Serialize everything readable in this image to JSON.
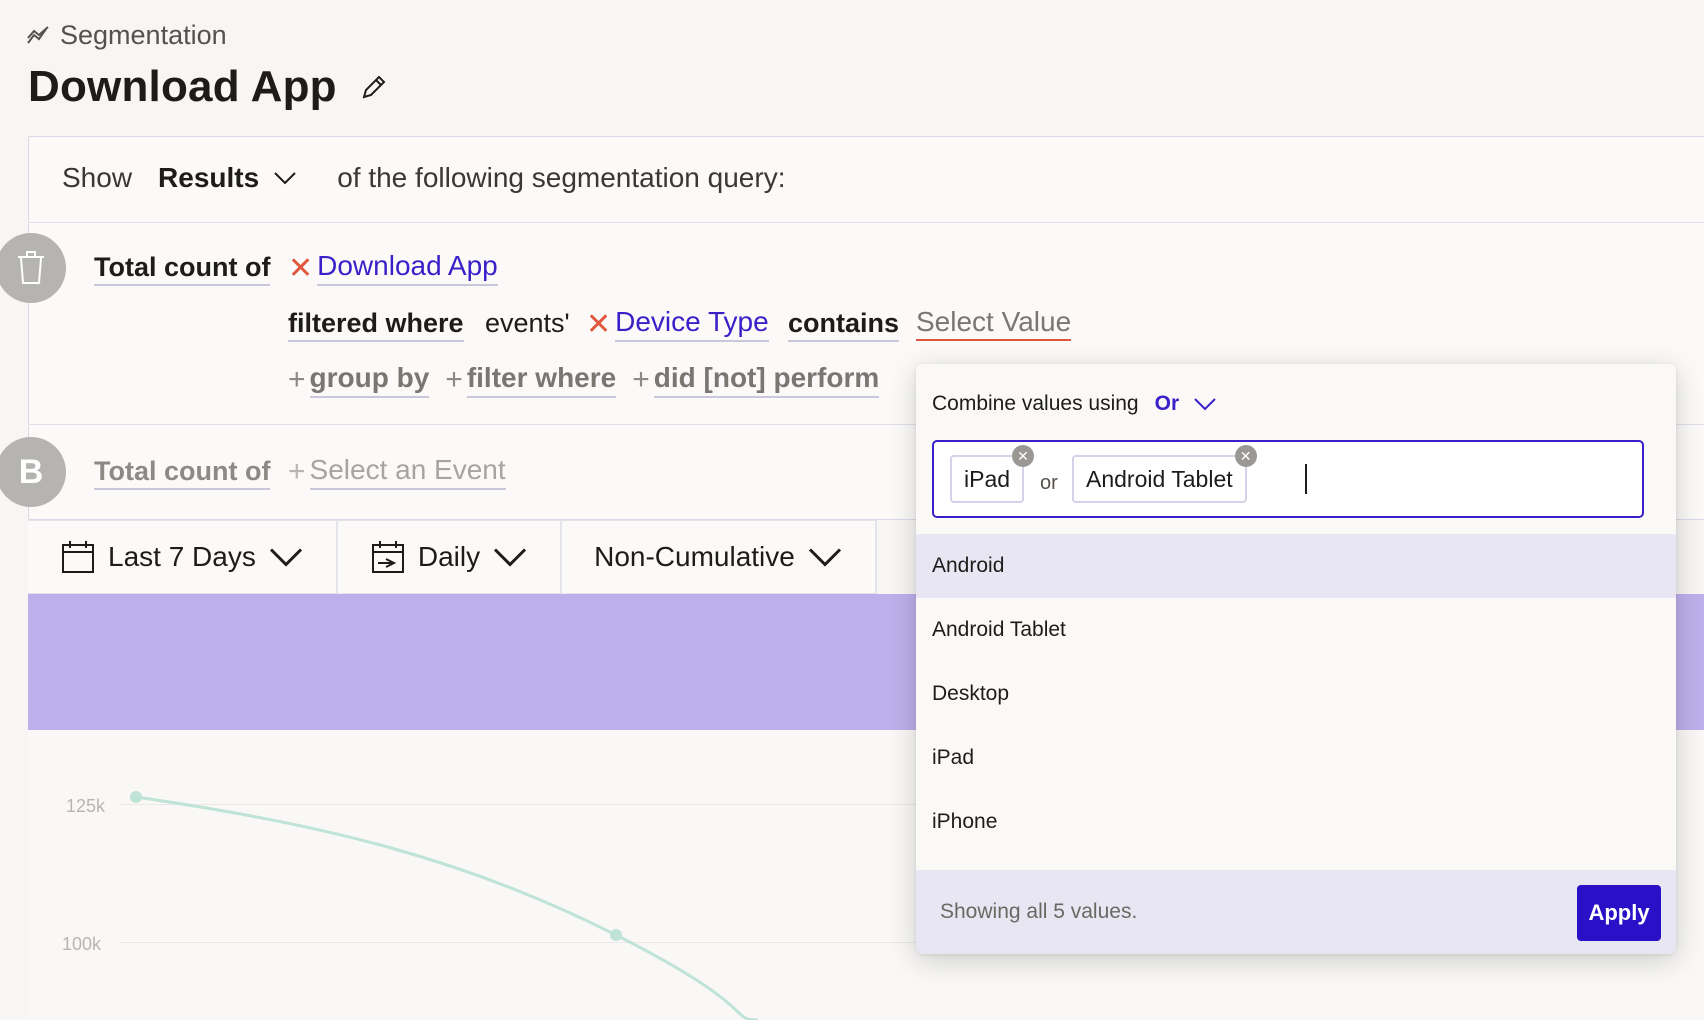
{
  "breadcrumb": {
    "label": "Segmentation"
  },
  "page": {
    "title": "Download App"
  },
  "query": {
    "show_label": "Show",
    "results_label": "Results",
    "tail_text": "of the following segmentation query:",
    "row_a": {
      "total_count_label": "Total count of",
      "event": "Download App",
      "filtered_where": "filtered where",
      "events_prefix": "events'",
      "property": "Device Type",
      "operator": "contains",
      "value_placeholder": "Select Value",
      "add_group_by": "group by",
      "add_filter_where": "filter where",
      "add_did_not_perform": "did [not] perform"
    },
    "row_b": {
      "letter": "B",
      "total_count_label": "Total count of",
      "select_event": "Select an Event"
    }
  },
  "controls": {
    "date_range": "Last 7 Days",
    "interval": "Daily",
    "mode": "Non-Cumulative"
  },
  "chart": {
    "y_ticks": [
      "125k",
      "100k"
    ]
  },
  "popover": {
    "combine_label": "Combine values using",
    "combine_value": "Or",
    "chips": [
      "iPad",
      "Android Tablet"
    ],
    "separator": "or",
    "options": [
      "Android",
      "Android Tablet",
      "Desktop",
      "iPad",
      "iPhone"
    ],
    "footer_text": "Showing all 5 values.",
    "apply_label": "Apply"
  },
  "colors": {
    "accent": "#3b1fc9",
    "band": "#bdb0ea",
    "line": "#bfe3d7",
    "delete_red": "#e0573c"
  }
}
